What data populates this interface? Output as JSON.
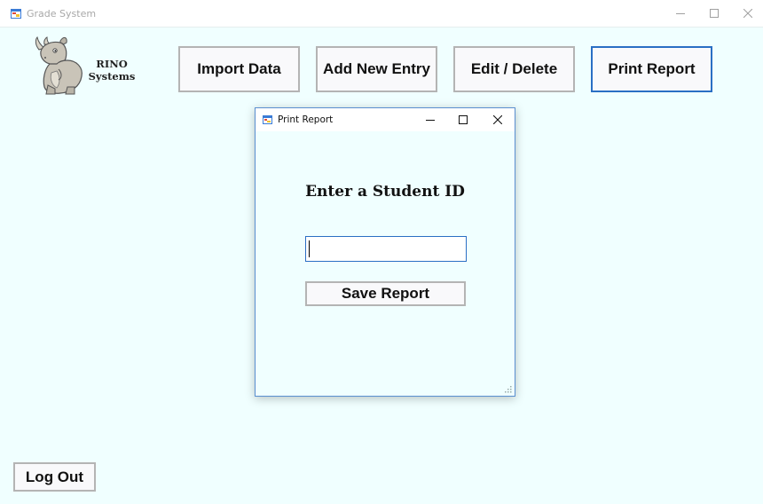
{
  "window": {
    "title": "Grade System",
    "icon": "app-form-icon",
    "controls": [
      "minimize-icon",
      "maximize-icon",
      "close-icon"
    ]
  },
  "brand": {
    "line1": "RINO",
    "line2": "Systems",
    "logo_icon": "rhino-logo-icon"
  },
  "nav": {
    "import_label": "Import Data",
    "add_label": "Add New Entry",
    "edit_label": "Edit / Delete",
    "print_label": "Print Report"
  },
  "dialog": {
    "title": "Print Report",
    "heading": "Enter a Student ID",
    "input_value": "",
    "save_label": "Save Report"
  },
  "footer": {
    "logout_label": "Log Out"
  },
  "colors": {
    "background": "#f0ffff",
    "active_border": "#2a6fc4",
    "button_border": "#b4b4b4"
  }
}
